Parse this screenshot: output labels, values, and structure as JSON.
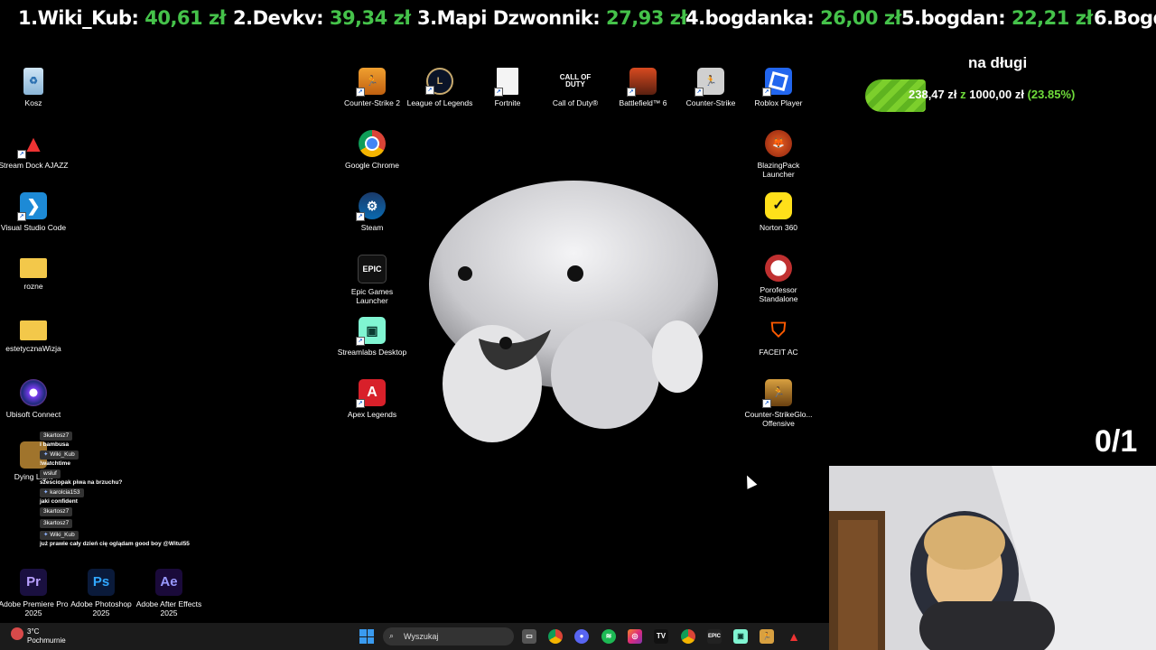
{
  "ticker": [
    {
      "label": "1.Wiki_Kub:",
      "amount": "40,61 zł"
    },
    {
      "label": "2.Devkv:",
      "amount": "39,34 zł"
    },
    {
      "label": "3.Mapi Dzwonnik:",
      "amount": "27,93 zł"
    },
    {
      "label": "4.bogdanka:",
      "amount": "26,00 zł"
    },
    {
      "label": "5.bogdan:",
      "amount": "22,21 zł"
    },
    {
      "label": "6.Bogd",
      "amount": ""
    }
  ],
  "desktop_icons": {
    "kosz": "Kosz",
    "stream_dock": "Stream Dock AJAZZ",
    "vscode": "Visual Studio Code",
    "rozne": "rozne",
    "estetyczna": "estetycznaWizja",
    "ubisoft": "Ubisoft Connect",
    "dying_light": "Dying Light",
    "premiere": "Adobe Premiere Pro 2025",
    "photoshop": "Adobe Photoshop 2025",
    "after_effects": "Adobe After Effects 2025",
    "cs2": "Counter-Strike 2",
    "lol": "League of Legends",
    "fortnite": "Fortnite",
    "cod": "Call of Duty®",
    "battlefield": "Battlefield™ 6",
    "counter_strike": "Counter-Strike",
    "roblox": "Roblox Player",
    "chrome": "Google Chrome",
    "steam": "Steam",
    "epic": "Epic Games Launcher",
    "streamlabs": "Streamlabs Desktop",
    "apex": "Apex Legends",
    "blazingpack": "BlazingPack Launcher",
    "norton": "Norton 360",
    "porofessor": "Porofessor Standalone",
    "faceit": "FACEIT AC",
    "csgo": "Counter-StrikeGlo... Offensive"
  },
  "icon_glyphs": {
    "cod": "CALL OF DUTY",
    "epic": "EPIC",
    "ps": "Ps",
    "ae": "Ae",
    "pr": "Pr"
  },
  "goal": {
    "title": "na długi",
    "current": "238,47 zł",
    "sep": "z",
    "target": "1000,00 zł",
    "percent_label": "(23.85%)",
    "progress": 0.2385
  },
  "counter": "0/1",
  "chat": [
    {
      "user": "3kartosz7",
      "text": "i bambusa",
      "badge": false
    },
    {
      "user": "Wiki_Kub",
      "text": "!watchtime",
      "badge": true
    },
    {
      "user": "wsluf",
      "text": "szesciopak piwa na brzuchu?",
      "badge": false
    },
    {
      "user": "karolcia153",
      "text": "jaki confident",
      "badge": true
    },
    {
      "user": "3kartosz7",
      "text": "",
      "badge": false
    },
    {
      "user": "3kartosz7",
      "text": "",
      "badge": false
    },
    {
      "user": "Wiki_Kub",
      "text": "już prawie cały dzień cię oglądam good boy @Witul55",
      "badge": true
    }
  ],
  "taskbar": {
    "temp": "3°C",
    "condition": "Pochmurnie",
    "search_placeholder": "Wyszukaj"
  },
  "colors": {
    "accent_green": "#45c24a",
    "bar_green": "#7ccf2c",
    "taskbar_bg": "#1b1b1b"
  }
}
